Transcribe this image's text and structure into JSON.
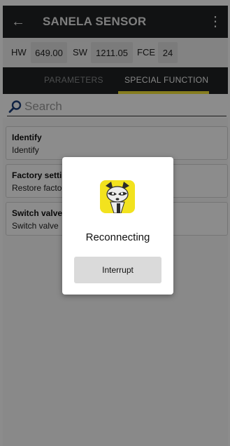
{
  "appbar": {
    "back_icon": "arrow-left-icon",
    "title": "SANELA SENSOR",
    "menu_icon": "more-vert-icon"
  },
  "info": {
    "hw_label": "HW",
    "hw_value": "649.00",
    "sw_label": "SW",
    "sw_value": "1211.05",
    "fce_label": "FCE",
    "fce_value": "24"
  },
  "tabs": [
    {
      "label": "PARAMETERS",
      "active": false
    },
    {
      "label": "SPECIAL FUNCTION",
      "active": true
    }
  ],
  "search": {
    "icon": "search-icon",
    "placeholder": "Search"
  },
  "items": [
    {
      "title": "Identify",
      "subtitle": "Identify"
    },
    {
      "title": "Factory settings",
      "subtitle": "Restore factory settings"
    },
    {
      "title": "Switch valve",
      "subtitle": "Switch valve"
    }
  ],
  "dialog": {
    "logo_icon": "raccoon-logo-icon",
    "message": "Reconnecting",
    "button_label": "Interrupt"
  },
  "colors": {
    "appbar": "#1f2223",
    "accent": "#f4e33a",
    "inforow": "#eeeeee"
  }
}
